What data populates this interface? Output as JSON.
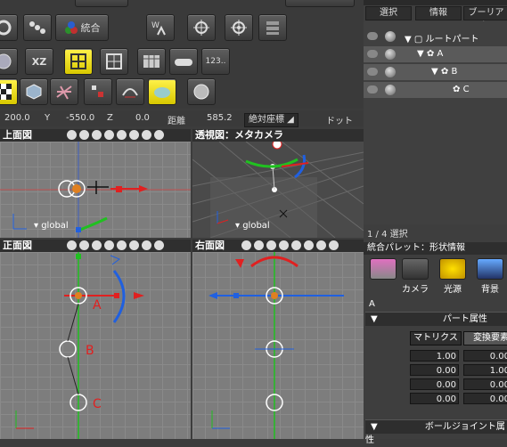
{
  "toolbar": {
    "buttons_row1": [
      "gear",
      "molecule",
      "combine",
      "wy",
      "crosshair1",
      "crosshair2",
      "stack"
    ],
    "combine_label": "統合",
    "row2_labels": [
      "globe",
      "XZ",
      "grid-yellow",
      "grid",
      "table",
      "car",
      "123.."
    ],
    "row3_icons": [
      "checker",
      "cube",
      "mesh",
      "scale",
      "curve",
      "cloud-yellow",
      "sphere"
    ]
  },
  "coords": {
    "x_value": "200.0",
    "y_label": "Y",
    "y_value": "-550.0",
    "z_label": "Z",
    "z_value": "0.0",
    "distance_label": "距離",
    "distance_value": "585.2",
    "mode_select": "絶対座標",
    "unit_label": "ドット"
  },
  "viewports": {
    "top": {
      "title": "上面図",
      "global": "global"
    },
    "persp": {
      "title": "透視図：メタカメラ",
      "global": "global"
    },
    "front": {
      "title": "正面図",
      "global": "global",
      "labels": [
        "A",
        "B",
        "C"
      ]
    },
    "right": {
      "title": "右面図"
    }
  },
  "browser": {
    "tabs": [
      "選択",
      "情報",
      "ブーリアン"
    ],
    "tree": [
      {
        "name": "ルートパート"
      },
      {
        "name": "A"
      },
      {
        "name": "B"
      },
      {
        "name": "C"
      }
    ],
    "selection_status": "1 / 4 選択"
  },
  "palette": {
    "title": "統合パレット：形状情報",
    "buttons": [
      "カメラ",
      "光源",
      "背景"
    ],
    "part_name": "A",
    "section_part_attr": "パート属性",
    "tabs": [
      "マトリクス",
      "変換要素"
    ],
    "matrix": [
      [
        "1.00",
        "0.00"
      ],
      [
        "0.00",
        "1.00"
      ],
      [
        "0.00",
        "0.00"
      ],
      [
        "0.00",
        "0.00"
      ]
    ],
    "section_ball_joint": "ボールジョイント属性"
  },
  "colors": {
    "accent_yellow": "#fff24a",
    "axis_red": "#e02020",
    "axis_green": "#20c020",
    "axis_blue": "#2060e0"
  }
}
